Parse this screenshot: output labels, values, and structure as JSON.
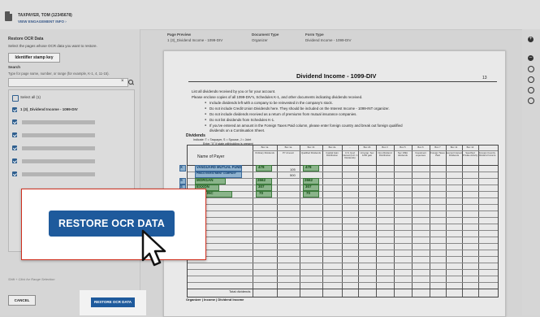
{
  "header": {
    "taxpayer": "TAXPAYER, TOM (12345678)",
    "engagement_link": "VIEW ENGAGEMENT INFO ›"
  },
  "left_panel": {
    "title": "Restore OCR Data",
    "description": "Select the pages whose OCR data you want to restore.",
    "stamp_key_button": "Identifier stamp key",
    "search_label": "Search",
    "search_hint": "Type for page name, number, or range (for example, K-1, 4, 11-15).",
    "search_value": "",
    "select_all": "Select all (1)",
    "items": [
      {
        "label": "1 (3)_Dividend Income - 1099-DIV",
        "checked": true
      }
    ],
    "shift_hint": "Shift + Click for Range Selection",
    "cancel_button": "CANCEL",
    "restore_button": "RESTORE OCR DATA"
  },
  "main": {
    "page_preview_label": "Page Preview",
    "page_preview_value": "1 (3)_Dividend Income - 1099-DIV",
    "document_type_label": "Document Type",
    "document_type_value": "Organizer",
    "form_type_label": "Form Type",
    "form_type_value": "Dividend Income - 1099-DIV"
  },
  "document": {
    "title": "Dividend Income - 1099-DIV",
    "page_number": "13",
    "intro_lines": [
      "List all dividends received by you or for your account.",
      "Please enclose copies of all 1099-DIV's, Schedules K-1, and other documents indicating dividends received."
    ],
    "bullets": [
      "Include dividends left with a company to be reinvested in the company's stock.",
      "Do not include Credit Union Dividends here. They should be included on the Interest Income - 1099-INT organizer.",
      "Do not include dividends received as a return of premiums from mutual insurance companies.",
      "Do not list dividends from Schedules K-1.",
      "If you've entered an amount in the Foreign Taxes Paid column, please enter foreign country and break out foreign qualified",
      "dividends on a Continuation Sheet."
    ],
    "section_label": "Dividends",
    "indicate": "Indicate: T = Taxpayer, S = Spouse, J = Joint",
    "enter_x": "Enter \"X\" if state withholding is present",
    "name_of_payer": "Name of Payer",
    "columns": [
      {
        "box": "Box 1a",
        "label": "Ordinary Dividends"
      },
      {
        "box": "Box 1a",
        "label": "PY Amount"
      },
      {
        "box": "Box 1b",
        "label": "Qualified Dividends"
      },
      {
        "box": "Box 2a",
        "label": "Capital Gain Distribution"
      },
      {
        "box": "-",
        "label": "U.S. Govt Interest (Incl. in Dividends)"
      },
      {
        "box": "Box 2b",
        "label": "Unrecap. Sec 1250 gain"
      },
      {
        "box": "Box 3",
        "label": "Non-Dividend Distribution"
      },
      {
        "box": "Box 5",
        "label": "Sec 199A dividends"
      },
      {
        "box": "Box 6",
        "label": "Investment expenses"
      },
      {
        "box": "Box 7",
        "label": "Foreign Taxes Paid"
      },
      {
        "box": "Box 11",
        "label": "Exempt Interest Dividends"
      },
      {
        "box": "Box 12",
        "label": "Specified Private Activity"
      },
      {
        "box": "",
        "label": "Foreign Country Dividend Income"
      }
    ],
    "rows": [
      {
        "tsj": "X",
        "payer": "VANGUARD MUTUAL FUND",
        "ordinary": "478",
        "py": "",
        "qualified": "478"
      },
      {
        "tsj": "",
        "payer": "PIMCO INVESTMENT COMPANY",
        "ordinary": "",
        "py": "105",
        "qualified": ""
      },
      {
        "tsj": "",
        "payer": "",
        "ordinary": "",
        "py": "500",
        "qualified": ""
      },
      {
        "tsj": "S",
        "payer": "MORGAN",
        "ordinary": "2662",
        "py": "",
        "qualified": "2662"
      },
      {
        "tsj": "S",
        "payer": "EXXON",
        "ordinary": "307",
        "py": "",
        "qualified": "307"
      },
      {
        "tsj": "J",
        "payer": "AT&T INC",
        "ordinary": "70",
        "py": "",
        "qualified": "70"
      }
    ],
    "total_label": "Total dividends",
    "footer_tabs": "Organizer | Income | Dividend Income"
  },
  "callout": {
    "button_label": "RESTORE OCR DATA"
  },
  "colors": {
    "primary_button": "#1e5a9c",
    "callout_border": "#d0301f",
    "ocr_green": "#8ab48a",
    "ocr_blue": "#8fb2cf"
  },
  "icons": [
    "document-icon",
    "search-icon",
    "clear-icon",
    "cursor-icon",
    "plus-icon",
    "minus-icon",
    "move-icon",
    "rotate-left-icon",
    "rotate-right-icon",
    "reset-icon"
  ]
}
